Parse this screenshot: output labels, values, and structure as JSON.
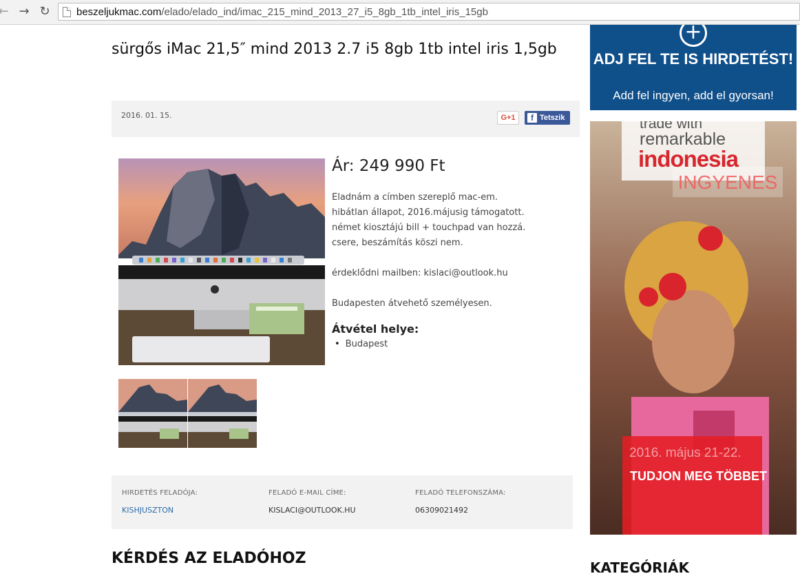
{
  "browser": {
    "url_domain": "beszeljukmac.com",
    "url_path": "/elado/elado_ind/imac_215_mind_2013_27_i5_8gb_1tb_intel_iris_15gb"
  },
  "listing": {
    "title": "sürgős iMac 21,5″ mind 2013 2.7 i5 8gb 1tb intel iris 1,5gb",
    "date": "2016. 01. 15.",
    "gplus_label": "G+1",
    "fb_label": "Tetszik",
    "price": "Ár: 249 990 Ft",
    "description": [
      "Eladnám a címben szereplő mac-em.",
      "hibátlan állapot, 2016.májusig támogatott.",
      "német kiosztájú bill + touchpad van hozzá.",
      "csere, beszámítás köszi nem.",
      "",
      "érdeklődni mailben: kislaci@outlook.hu",
      "",
      "Budapesten átvehető személyesen."
    ],
    "pickup_title": "Átvétel helye:",
    "pickup_locations": [
      "Budapest"
    ]
  },
  "seller": {
    "name_label": "HIRDETÉS FELADÓJA:",
    "name_value": "KISHJUSZTON",
    "email_label": "FELADÓ E-MAIL CÍME:",
    "email_value": "KISLACI@OUTLOOK.HU",
    "phone_label": "FELADÓ TELEFONSZÁMA:",
    "phone_value": "06309021492"
  },
  "question_heading": "KÉRDÉS AZ ELADÓHOZ",
  "sidebar": {
    "ad_title": "ADJ FEL TE IS HIRDETÉST!",
    "ad_sub": "Add fel ingyen, add el gyorsan!",
    "banner": {
      "line1": "trade with",
      "line2": "remarkable",
      "line3": "indonesia",
      "free": "INGYENES",
      "date": "2016. május 21-22.",
      "cta": "TUDJON MEG TÖBBET"
    },
    "categories_heading": "KATEGÓRIÁK"
  },
  "colors": {
    "ad_blue": "#0f4f8a",
    "facebook_blue": "#3b5998",
    "banner_red": "#e41e24",
    "link_blue": "#2a6aa8"
  }
}
